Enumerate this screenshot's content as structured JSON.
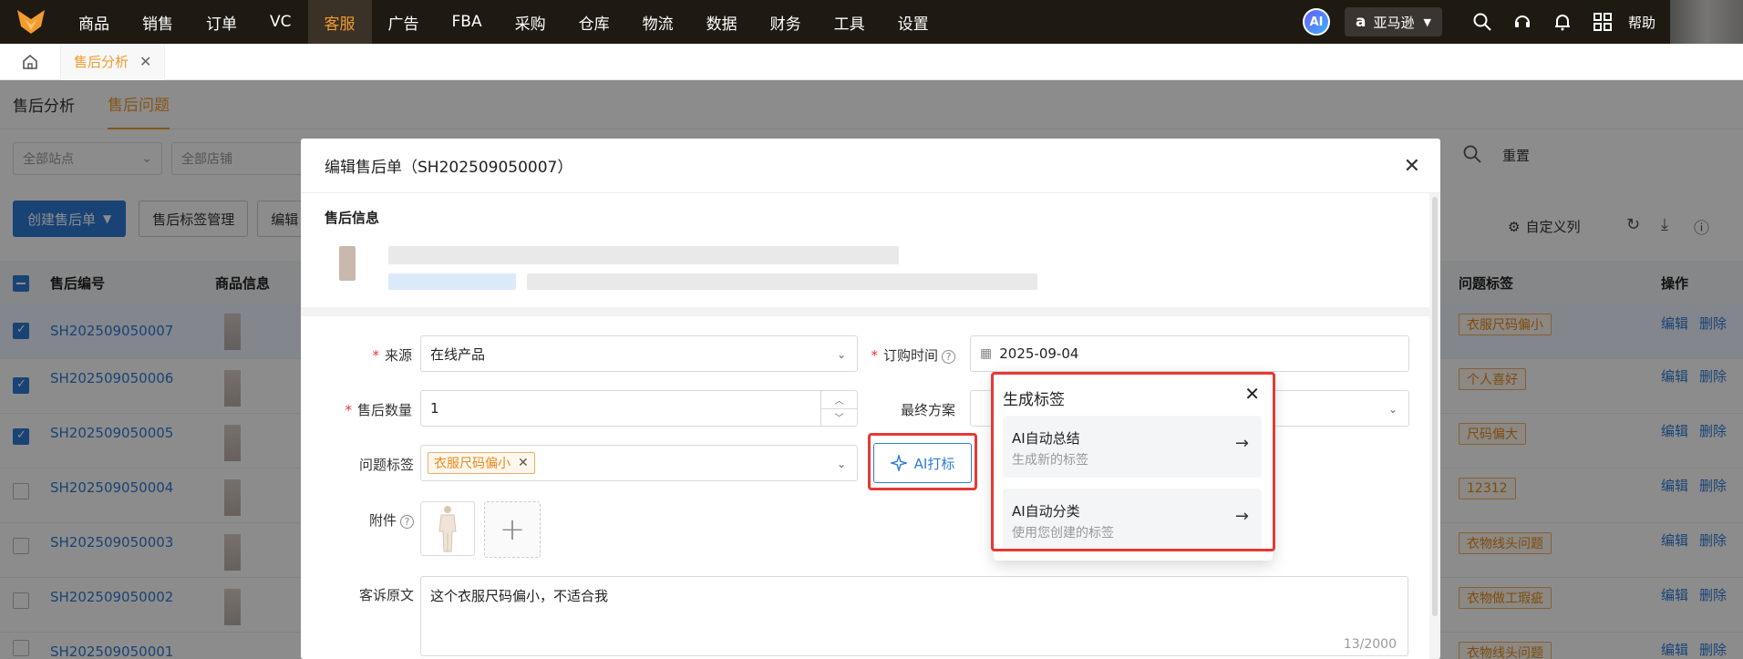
{
  "topnav": {
    "items": [
      "商品",
      "销售",
      "订单",
      "VC",
      "客服",
      "广告",
      "FBA",
      "采购",
      "仓库",
      "物流",
      "数据",
      "财务",
      "工具",
      "设置"
    ],
    "active_index": 4,
    "ai_badge": "AI",
    "store_selector": "亚马逊",
    "help_label": "帮助"
  },
  "tabbar": {
    "open_tab": "售后分析"
  },
  "page": {
    "subtabs": [
      "售后分析",
      "售后问题"
    ],
    "active_subtab": 1,
    "filters": [
      "全部站点",
      "全部店铺"
    ],
    "reset_label": "重置",
    "create_button": "创建售后单",
    "tag_manage_button": "售后标签管理",
    "edit_button_partial": "编辑",
    "custom_columns": "自定义列",
    "columns": {
      "id": "售后编号",
      "product": "商品信息",
      "tags": "问题标签",
      "ops": "操作"
    },
    "rows": [
      {
        "id": "SH202509050007",
        "tag": "衣服尺码偏小",
        "checked": true
      },
      {
        "id": "SH202509050006",
        "tag": "个人喜好",
        "checked": true
      },
      {
        "id": "SH202509050005",
        "tag": "尺码偏大",
        "checked": true
      },
      {
        "id": "SH202509050004",
        "tag": "12312",
        "checked": false
      },
      {
        "id": "SH202509050003",
        "tag": "衣物线头问题",
        "checked": false
      },
      {
        "id": "SH202509050002",
        "tag": "衣物做工瑕疵",
        "checked": false
      },
      {
        "id": "SH202509050001",
        "tag": "衣物线头问题",
        "checked": false
      }
    ],
    "op_edit": "编辑",
    "op_delete": "删除"
  },
  "modal": {
    "title": "编辑售后单（SH202509050007）",
    "section_title": "售后信息",
    "source_label": "来源",
    "source_value": "在线产品",
    "order_time_label": "订购时间",
    "order_time_value": "2025-09-04",
    "qty_label": "售后数量",
    "qty_value": "1",
    "final_plan_label": "最终方案",
    "tags_label": "问题标签",
    "tag_chip": "衣服尺码偏小",
    "ai_tag_button": "AI打标",
    "attachment_label": "附件",
    "complaint_label": "客诉原文",
    "complaint_text": "这个衣服尺码偏小，不适合我",
    "complaint_counter": "13/2000"
  },
  "popover": {
    "title": "生成标签",
    "options": [
      {
        "title": "AI自动总结",
        "desc": "生成新的标签"
      },
      {
        "title": "AI自动分类",
        "desc": "使用您创建的标签"
      }
    ]
  },
  "colors": {
    "accent": "#f29b2f",
    "primary": "#2e7bd6",
    "highlight_red": "#e53935",
    "nav_bg": "#1e1a12"
  }
}
